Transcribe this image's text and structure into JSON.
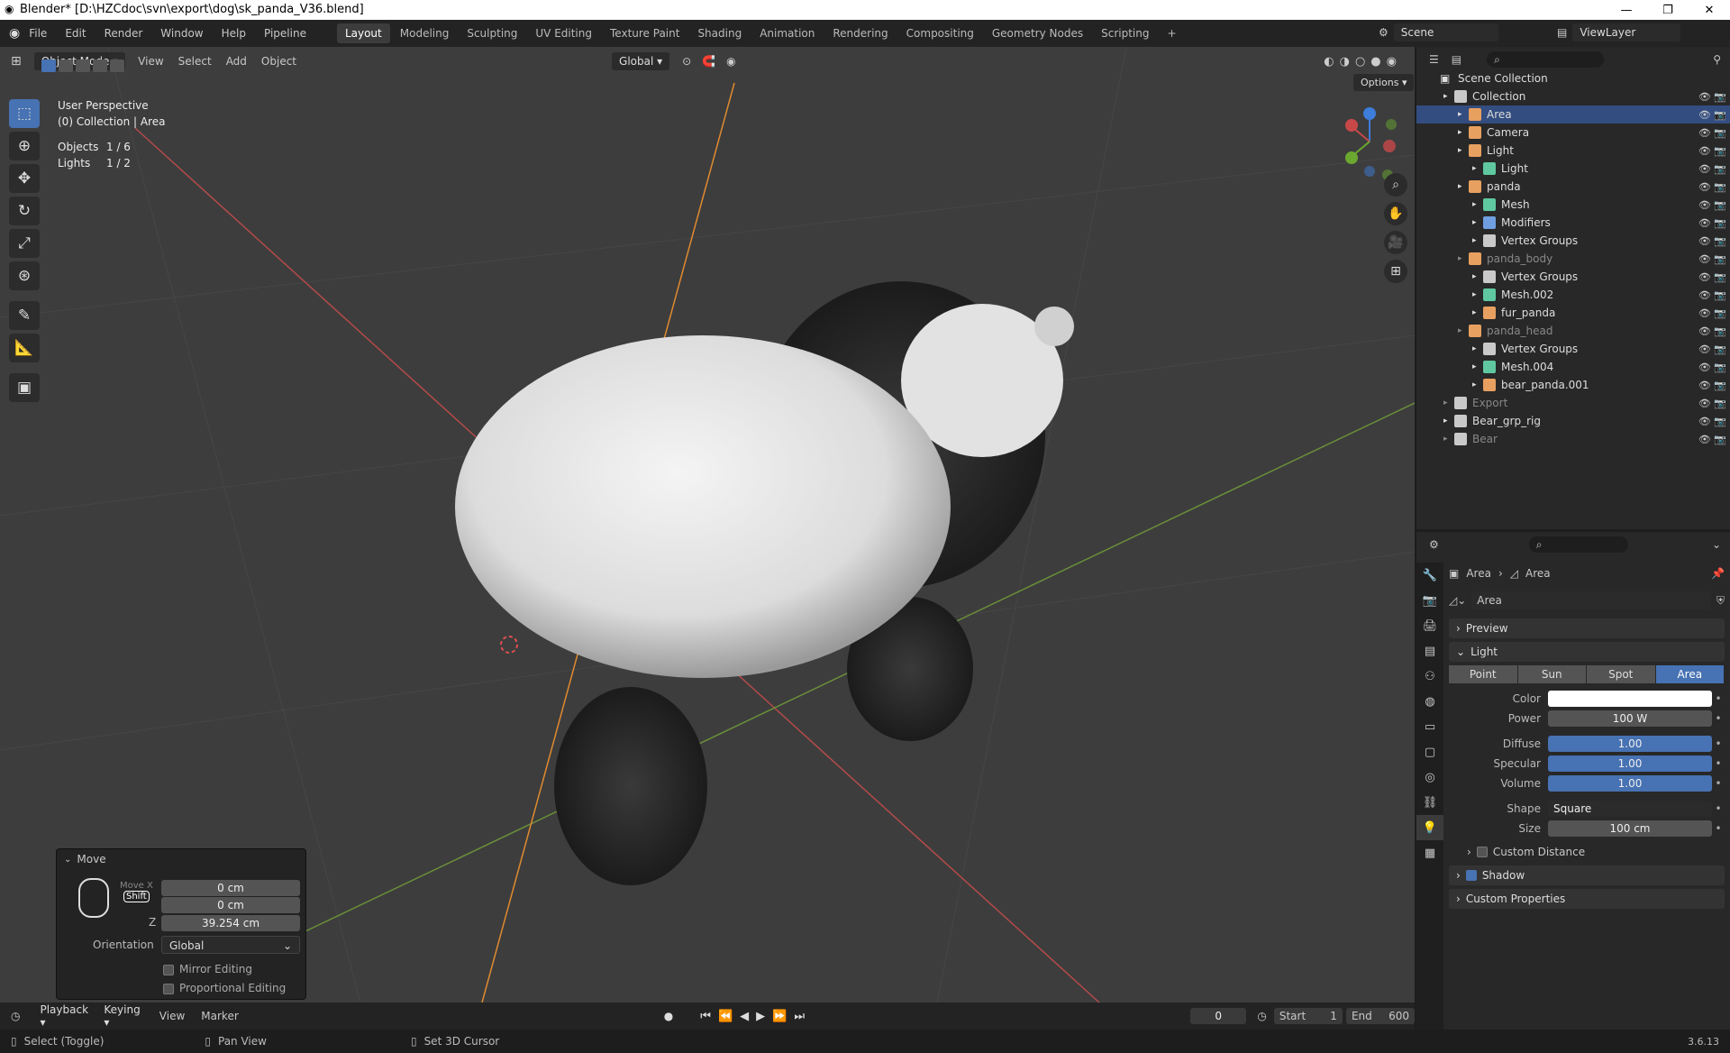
{
  "window": {
    "title": "Blender* [D:\\HZCdoc\\svn\\export\\dog\\sk_panda_V36.blend]",
    "controls": [
      "—",
      "❐",
      "✕"
    ]
  },
  "menu": [
    "File",
    "Edit",
    "Render",
    "Window",
    "Help",
    "Pipeline"
  ],
  "workspaces": {
    "tabs": [
      "Layout",
      "Modeling",
      "Sculpting",
      "UV Editing",
      "Texture Paint",
      "Shading",
      "Animation",
      "Rendering",
      "Compositing",
      "Geometry Nodes",
      "Scripting"
    ],
    "active": "Layout",
    "add": "+"
  },
  "scene": {
    "label": "Scene",
    "view_layer": "ViewLayer"
  },
  "viewport": {
    "mode": "Object Mode",
    "menus": [
      "View",
      "Select",
      "Add",
      "Object"
    ],
    "orientation": "Global",
    "options_label": "Options",
    "perspective": "User Perspective",
    "collection_info": "(0) Collection | Area",
    "stats": [
      {
        "label": "Objects",
        "value": "1 / 6"
      },
      {
        "label": "Lights",
        "value": "1 / 2"
      }
    ]
  },
  "move_panel": {
    "title": "Move",
    "move_x_label": "Move X",
    "shift_badge": "Shift",
    "x": "0 cm",
    "y": "0 cm",
    "z_label": "Z",
    "z": "39.254 cm",
    "orientation_label": "Orientation",
    "orientation": "Global",
    "mirror": "Mirror Editing",
    "proportional": "Proportional Editing"
  },
  "timeline": {
    "menus": [
      "Playback",
      "Keying",
      "View",
      "Marker"
    ],
    "current": "0",
    "start_label": "Start",
    "start": "1",
    "end_label": "End",
    "end": "600"
  },
  "status": {
    "items": [
      "Select (Toggle)",
      "Pan View",
      "Set 3D Cursor"
    ],
    "version": "3.6.13"
  },
  "outliner": {
    "root": "Scene Collection",
    "rows": [
      {
        "label": "Collection",
        "indent": 1,
        "color": "#c9c9c9"
      },
      {
        "label": "Area",
        "indent": 2,
        "color": "#e8a060",
        "selected": true
      },
      {
        "label": "Camera",
        "indent": 2,
        "color": "#e8a060"
      },
      {
        "label": "Light",
        "indent": 2,
        "color": "#e8a060"
      },
      {
        "label": "Light",
        "indent": 3,
        "color": "#5fc8a0"
      },
      {
        "label": "panda",
        "indent": 2,
        "color": "#e8a060"
      },
      {
        "label": "Mesh",
        "indent": 3,
        "color": "#5fc8a0"
      },
      {
        "label": "Modifiers",
        "indent": 3,
        "color": "#6f9fe0"
      },
      {
        "label": "Vertex Groups",
        "indent": 3,
        "color": "#c9c9c9"
      },
      {
        "label": "panda_body",
        "indent": 2,
        "color": "#e8a060",
        "dim": true
      },
      {
        "label": "Vertex Groups",
        "indent": 3,
        "color": "#c9c9c9"
      },
      {
        "label": "Mesh.002",
        "indent": 3,
        "color": "#5fc8a0"
      },
      {
        "label": "fur_panda",
        "indent": 3,
        "color": "#e8a060"
      },
      {
        "label": "panda_head",
        "indent": 2,
        "color": "#e8a060",
        "dim": true
      },
      {
        "label": "Vertex Groups",
        "indent": 3,
        "color": "#c9c9c9"
      },
      {
        "label": "Mesh.004",
        "indent": 3,
        "color": "#5fc8a0"
      },
      {
        "label": "bear_panda.001",
        "indent": 3,
        "color": "#e8a060"
      },
      {
        "label": "Export",
        "indent": 1,
        "color": "#c9c9c9",
        "dim": true
      },
      {
        "label": "Bear_grp_rig",
        "indent": 1,
        "color": "#c9c9c9"
      },
      {
        "label": "Bear",
        "indent": 1,
        "color": "#c9c9c9",
        "dim": true
      }
    ]
  },
  "properties": {
    "breadcrumb": [
      "Area",
      "Area"
    ],
    "datablock": "Area",
    "panels": {
      "preview": "Preview",
      "light": "Light",
      "custom_distance": "Custom Distance",
      "shadow": "Shadow",
      "custom_properties": "Custom Properties"
    },
    "light_types": [
      "Point",
      "Sun",
      "Spot",
      "Area"
    ],
    "light_type_active": "Area",
    "fields": [
      {
        "label": "Color",
        "value": "",
        "style": "white"
      },
      {
        "label": "Power",
        "value": "100 W",
        "style": "grey"
      },
      {
        "label": "Diffuse",
        "value": "1.00",
        "style": "blue"
      },
      {
        "label": "Specular",
        "value": "1.00",
        "style": "blue"
      },
      {
        "label": "Volume",
        "value": "1.00",
        "style": "blue"
      },
      {
        "label": "Shape",
        "value": "Square",
        "style": "dropdown"
      },
      {
        "label": "Size",
        "value": "100 cm",
        "style": "grey"
      }
    ]
  }
}
